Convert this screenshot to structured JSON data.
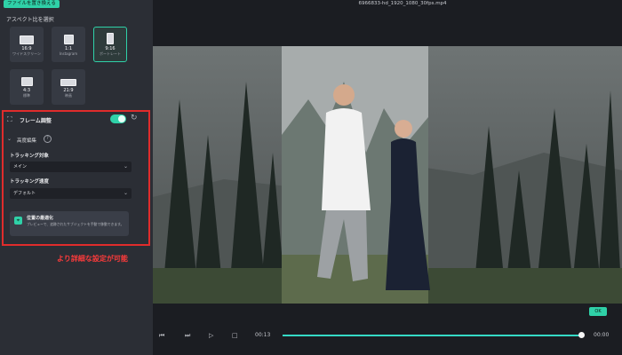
{
  "header": {
    "replace_file_button": "ファイルを置き換える",
    "filename": "6966833-hd_1920_1080_30fps.mp4"
  },
  "aspect": {
    "title": "アスペクト比を選択",
    "options": [
      {
        "ratio": "16:9",
        "sub": "ワイドスクリーン",
        "selected": false
      },
      {
        "ratio": "1:1",
        "sub": "Instagram",
        "selected": false
      },
      {
        "ratio": "9:16",
        "sub": "ポートレート",
        "selected": true
      },
      {
        "ratio": "4:3",
        "sub": "標準",
        "selected": false
      },
      {
        "ratio": "21:9",
        "sub": "映画",
        "selected": false
      }
    ]
  },
  "frame": {
    "label": "フレーム調整",
    "enabled": true,
    "advanced_label": "高度編集",
    "tracking_target_label": "トラッキング対象",
    "tracking_target_value": "メイン",
    "tracking_speed_label": "トラッキング速度",
    "tracking_speed_value": "デフォルト",
    "notice_title": "位置の最適化",
    "notice_text": "プレビューで、追跡されたサブジェクトを手動で移動できます。"
  },
  "caption": "より詳細な設定が可能",
  "player": {
    "ok_label": "OK",
    "current_time": "00:13",
    "end_time": "00:00",
    "progress": 0.99
  },
  "colors": {
    "accent": "#2fd1a8",
    "highlight_border": "#e02c2c",
    "caption": "#ff3b3b"
  }
}
